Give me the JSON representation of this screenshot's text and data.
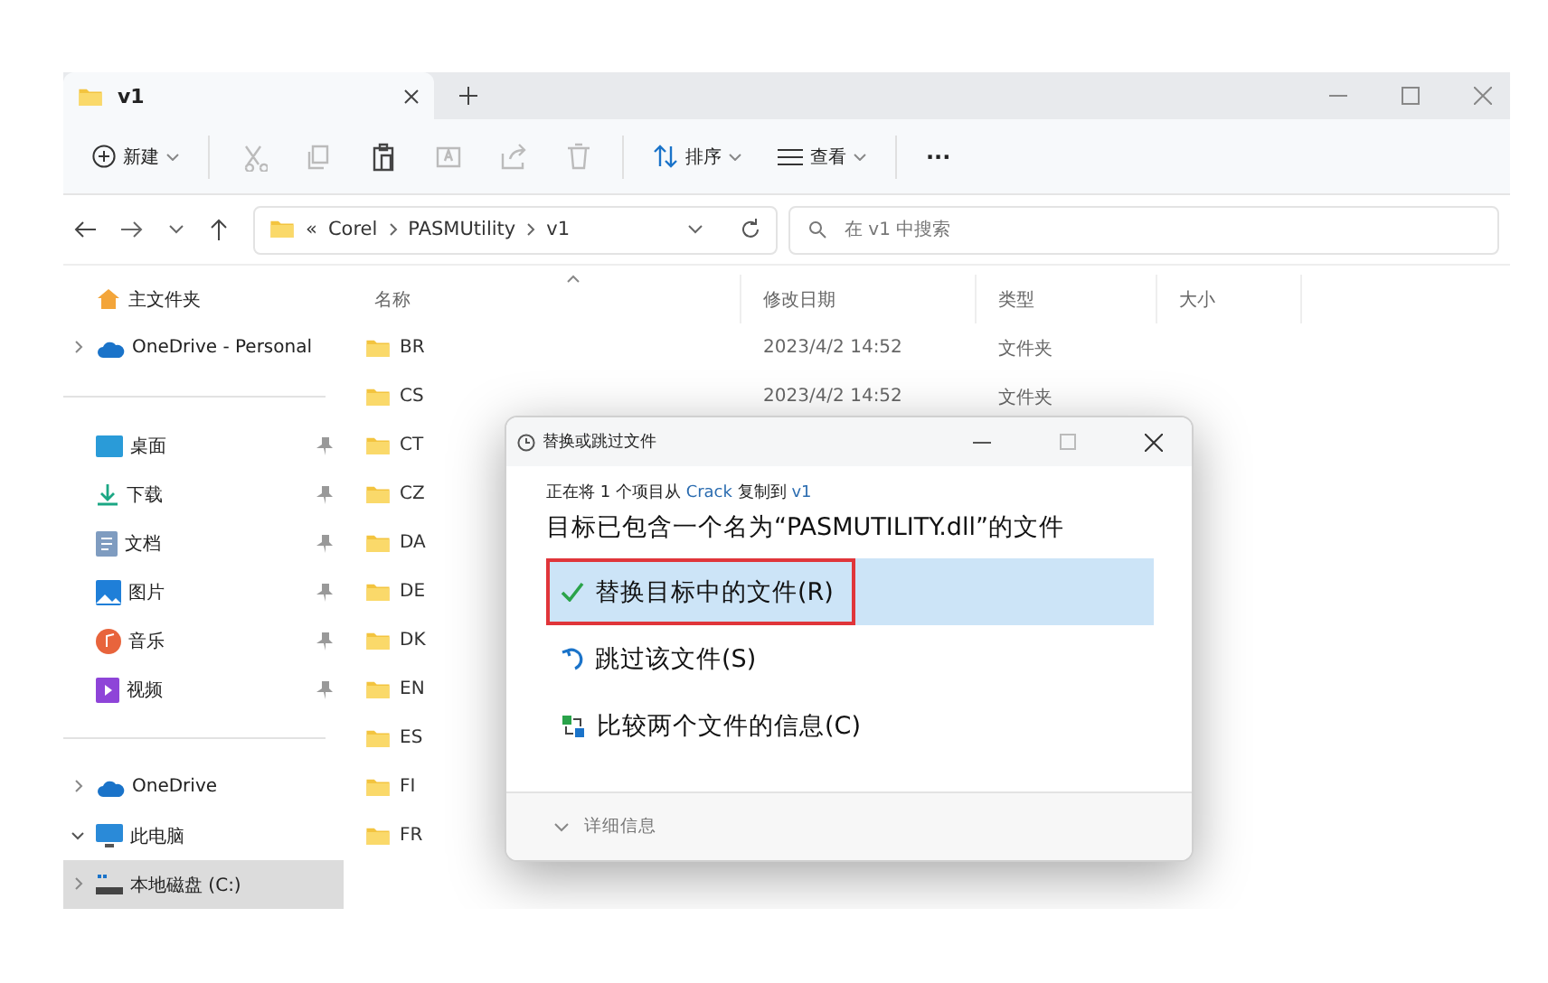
{
  "tab": {
    "title": "v1",
    "selected": true
  },
  "toolbar": {
    "new_label": "新建",
    "sort_label": "排序",
    "view_label": "查看",
    "more": "···"
  },
  "address": {
    "overflow": "«",
    "crumbs": [
      "Corel",
      "PASMUtility",
      "v1"
    ],
    "search_placeholder": "在 v1 中搜索"
  },
  "sidebar": {
    "items": [
      {
        "kind": "home",
        "label": "主文件夹",
        "pinned": false,
        "selected": false
      },
      {
        "kind": "cloud",
        "label": "OneDrive - Personal",
        "pinned": false,
        "expanded": false,
        "selected": false
      },
      {
        "kind": "separator"
      },
      {
        "kind": "desktop",
        "label": "桌面",
        "pinned": true,
        "selected": false
      },
      {
        "kind": "download",
        "label": "下载",
        "pinned": true,
        "selected": false
      },
      {
        "kind": "documents",
        "label": "文档",
        "pinned": true,
        "selected": false
      },
      {
        "kind": "pictures",
        "label": "图片",
        "pinned": true,
        "selected": false
      },
      {
        "kind": "music",
        "label": "音乐",
        "pinned": true,
        "selected": false
      },
      {
        "kind": "video",
        "label": "视频",
        "pinned": true,
        "selected": false
      },
      {
        "kind": "separator"
      },
      {
        "kind": "cloud",
        "label": "OneDrive",
        "pinned": false,
        "expanded": false,
        "selected": false
      },
      {
        "kind": "computer",
        "label": "此电脑",
        "pinned": false,
        "expanded": true,
        "selected": false
      },
      {
        "kind": "drive",
        "label": "本地磁盘 (C:)",
        "pinned": false,
        "expanded": false,
        "selected": true
      }
    ]
  },
  "table": {
    "columns": [
      "名称",
      "修改日期",
      "类型",
      "大小"
    ],
    "rows": [
      {
        "name": "BR",
        "modified": "2023/4/2 14:52",
        "type": "文件夹"
      },
      {
        "name": "CS",
        "modified": "2023/4/2 14:52",
        "type": "文件夹"
      },
      {
        "name": "CT"
      },
      {
        "name": "CZ"
      },
      {
        "name": "DA"
      },
      {
        "name": "DE"
      },
      {
        "name": "DK"
      },
      {
        "name": "EN"
      },
      {
        "name": "ES"
      },
      {
        "name": "FI"
      },
      {
        "name": "FR"
      }
    ]
  },
  "dialog": {
    "title": "替换或跳过文件",
    "status_parts": [
      "正在将 1 个项目从 ",
      "Crack",
      " 复制到 ",
      "v1"
    ],
    "message": "目标已包含一个名为“PASMUTILITY.dll”的文件",
    "options": [
      {
        "kind": "replace",
        "label": "替换目标中的文件(R)",
        "selected": true
      },
      {
        "kind": "skip",
        "label": "跳过该文件(S)",
        "selected": false
      },
      {
        "kind": "compare",
        "label": "比较两个文件的信息(C)",
        "selected": false
      }
    ],
    "details": "详细信息"
  }
}
